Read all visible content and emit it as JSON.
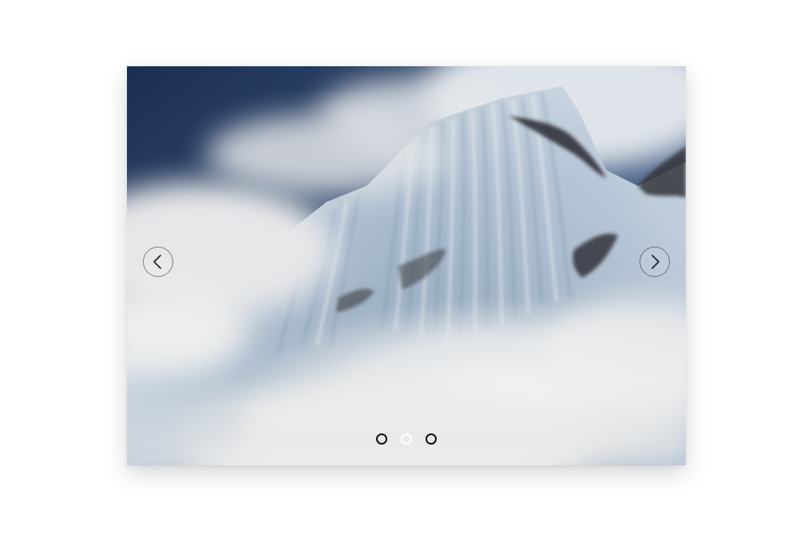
{
  "slider": {
    "image": {
      "icon": "snow-mountain-image",
      "alt": ""
    },
    "prev": {
      "icon": "chevron-left-icon"
    },
    "next": {
      "icon": "chevron-right-icon"
    },
    "dots": [
      {
        "active": false
      },
      {
        "active": true
      },
      {
        "active": false
      }
    ]
  },
  "colors": {
    "sky": "#1f3558",
    "cloud": "#e9ebee",
    "ice": "#c8d5e2",
    "rock": "#2a2b2e",
    "dot_inactive": "#111111",
    "dot_active": "#ffffff"
  }
}
